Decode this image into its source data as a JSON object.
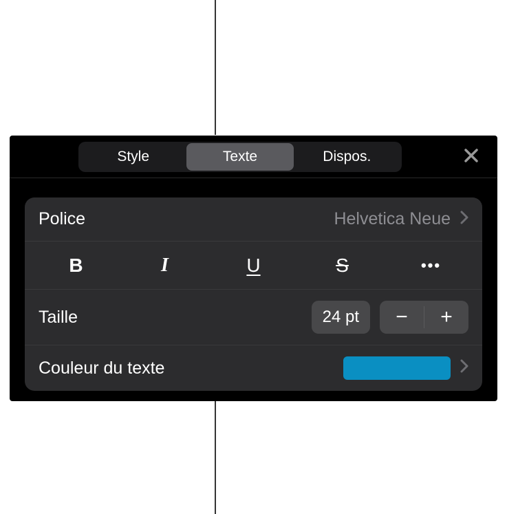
{
  "tabs": {
    "style": "Style",
    "text": "Texte",
    "layout": "Dispos."
  },
  "font": {
    "label": "Police",
    "value": "Helvetica Neue"
  },
  "size": {
    "label": "Taille",
    "value": "24 pt"
  },
  "textColor": {
    "label": "Couleur du texte",
    "swatch": "#0a8fc2"
  },
  "glyphs": {
    "bold": "B",
    "italic": "I",
    "underline": "U",
    "strike": "S",
    "more": "•••",
    "minus": "−",
    "plus": "+"
  }
}
